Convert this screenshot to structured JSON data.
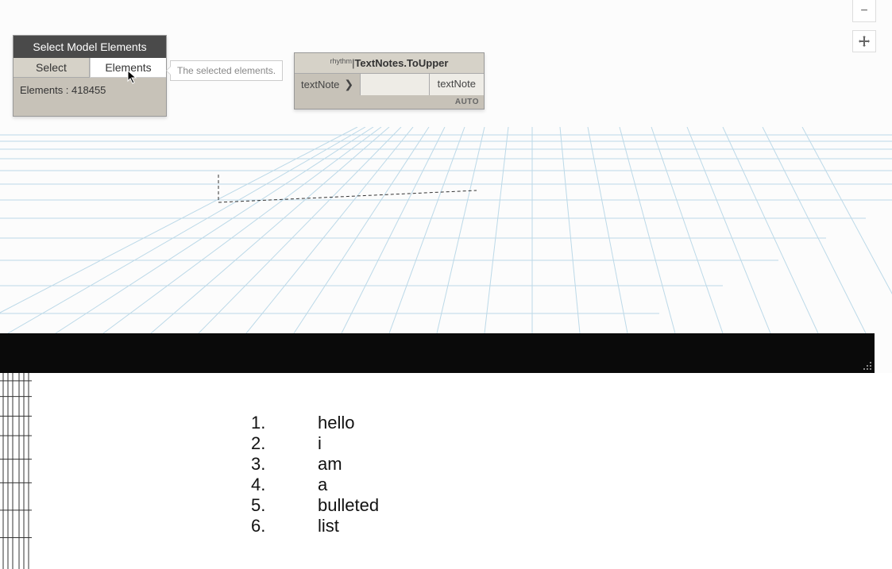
{
  "node1": {
    "title": "Select Model Elements",
    "select_btn": "Select",
    "output_port": "Elements",
    "status": "Elements : 418455"
  },
  "tooltip": "The selected elements.",
  "node2": {
    "prefix": "rhythm",
    "sep": "|",
    "title": "TextNotes.ToUpper",
    "input_port": "textNote",
    "output_port": "textNote",
    "lacing": "AUTO"
  },
  "zoom": {
    "in": "+",
    "out": "−"
  },
  "list": {
    "items": [
      {
        "n": "1.",
        "t": "hello"
      },
      {
        "n": "2.",
        "t": "i"
      },
      {
        "n": "3.",
        "t": "am"
      },
      {
        "n": "4.",
        "t": "a"
      },
      {
        "n": "5.",
        "t": "bulleted"
      },
      {
        "n": "6.",
        "t": "list"
      }
    ]
  }
}
